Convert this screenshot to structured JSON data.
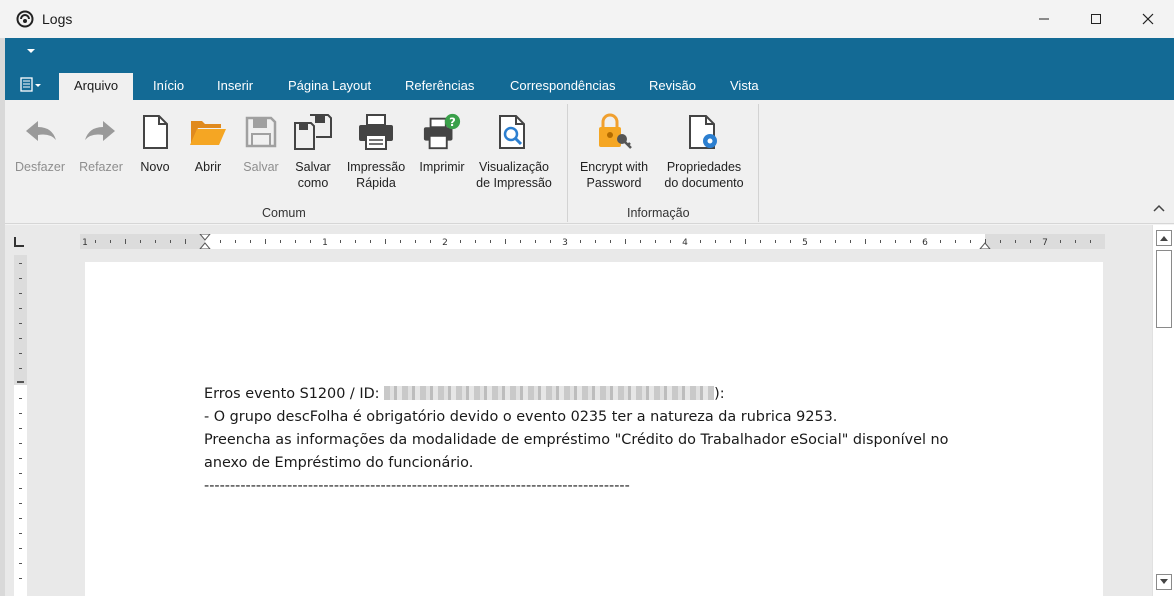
{
  "window": {
    "title": "Logs"
  },
  "tabs": [
    {
      "label": "Arquivo",
      "active": true
    },
    {
      "label": "Início"
    },
    {
      "label": "Inserir"
    },
    {
      "label": "Página Layout"
    },
    {
      "label": "Referências"
    },
    {
      "label": "Correspondências"
    },
    {
      "label": "Revisão"
    },
    {
      "label": "Vista"
    }
  ],
  "ribbon": {
    "buttons": {
      "undo": "Desfazer",
      "redo": "Refazer",
      "new": "Novo",
      "open": "Abrir",
      "save": "Salvar",
      "save_as": "Salvar\ncomo",
      "quick_print": "Impressão\nRápida",
      "print": "Imprimir",
      "print_preview": "Visualização\nde Impressão",
      "encrypt": "Encrypt with\nPassword",
      "properties": "Propriedades\ndo documento"
    },
    "groups": {
      "common": "Comum",
      "info": "Informação"
    }
  },
  "ruler": {
    "numbers": [
      "1",
      "1",
      "2",
      "3",
      "4",
      "5",
      "6",
      "7"
    ]
  },
  "document": {
    "line1_prefix": "Erros evento S1200 / ID: ",
    "line1_suffix": "):",
    "line2": "- O grupo descFolha é obrigatório devido o evento 0235 ter a natureza da rubrica 9253.",
    "line3": "Preencha as informações da modalidade de empréstimo \"Crédito do Trabalhador eSocial\" disponível no",
    "line4": "anexo de Empréstimo do funcionário.",
    "line5": "----------------------------------------------------------------------------------"
  },
  "colors": {
    "ribbon_blue": "#136a95",
    "open_folder": "#f0a030",
    "info_green": "#3aa04a",
    "accent_blue": "#2c7fd0"
  },
  "icons": [
    "logs-app-icon",
    "minimize-icon",
    "maximize-icon",
    "close-icon",
    "undo-icon",
    "redo-icon",
    "new-document-icon",
    "open-folder-icon",
    "save-icon",
    "save-as-icon",
    "quick-print-icon",
    "print-icon",
    "print-preview-icon",
    "lock-key-icon",
    "document-properties-icon",
    "chevron-up-icon"
  ]
}
